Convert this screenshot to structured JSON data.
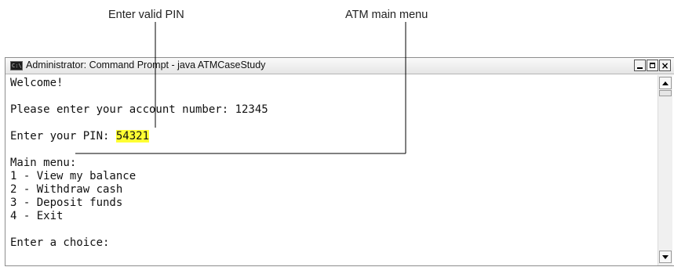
{
  "callouts": {
    "pin_label": "Enter valid PIN",
    "menu_label": "ATM main menu"
  },
  "window": {
    "title": "Administrator: Command Prompt - java  ATMCaseStudy",
    "icon": "cmd-icon",
    "buttons": [
      "minimize-icon",
      "maximize-icon",
      "close-icon"
    ]
  },
  "console": {
    "welcome": "Welcome!",
    "account_prompt": "Please enter your account number: 12345",
    "pin_prompt": "Enter your PIN: ",
    "pin_value": "54321",
    "menu_header": "Main menu:",
    "menu_items": [
      "1 - View my balance",
      "2 - Withdraw cash",
      "3 - Deposit funds",
      "4 - Exit"
    ],
    "choice_prompt": "Enter a choice:"
  },
  "colors": {
    "pin_highlight": "#ffff33",
    "leader_line": "#000000"
  }
}
